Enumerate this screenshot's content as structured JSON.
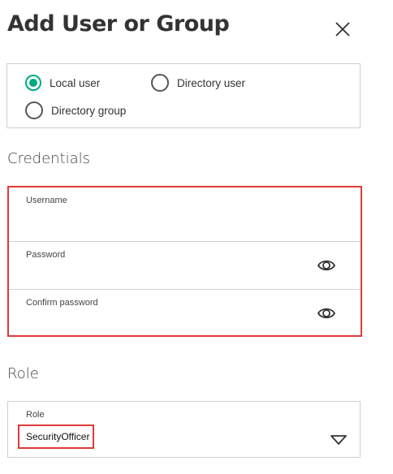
{
  "dialog": {
    "title": "Add User or Group"
  },
  "type_selector": {
    "options": [
      {
        "label": "Local user",
        "selected": true
      },
      {
        "label": "Directory user",
        "selected": false
      },
      {
        "label": "Directory group",
        "selected": false
      }
    ]
  },
  "credentials": {
    "section_title": "Credentials",
    "username_label": "Username",
    "username_value": "",
    "password_label": "Password",
    "password_value": "",
    "confirm_label": "Confirm password",
    "confirm_value": ""
  },
  "role": {
    "section_title": "Role",
    "field_label": "Role",
    "selected_value": "SecurityOfficer"
  },
  "colors": {
    "accent": "#01a982",
    "highlight": "#e03a3a",
    "border": "#cfcfcf",
    "text": "#333333"
  },
  "icons": {
    "close": "close-icon",
    "reveal_password": "eye-icon",
    "dropdown": "chevron-down-icon"
  }
}
